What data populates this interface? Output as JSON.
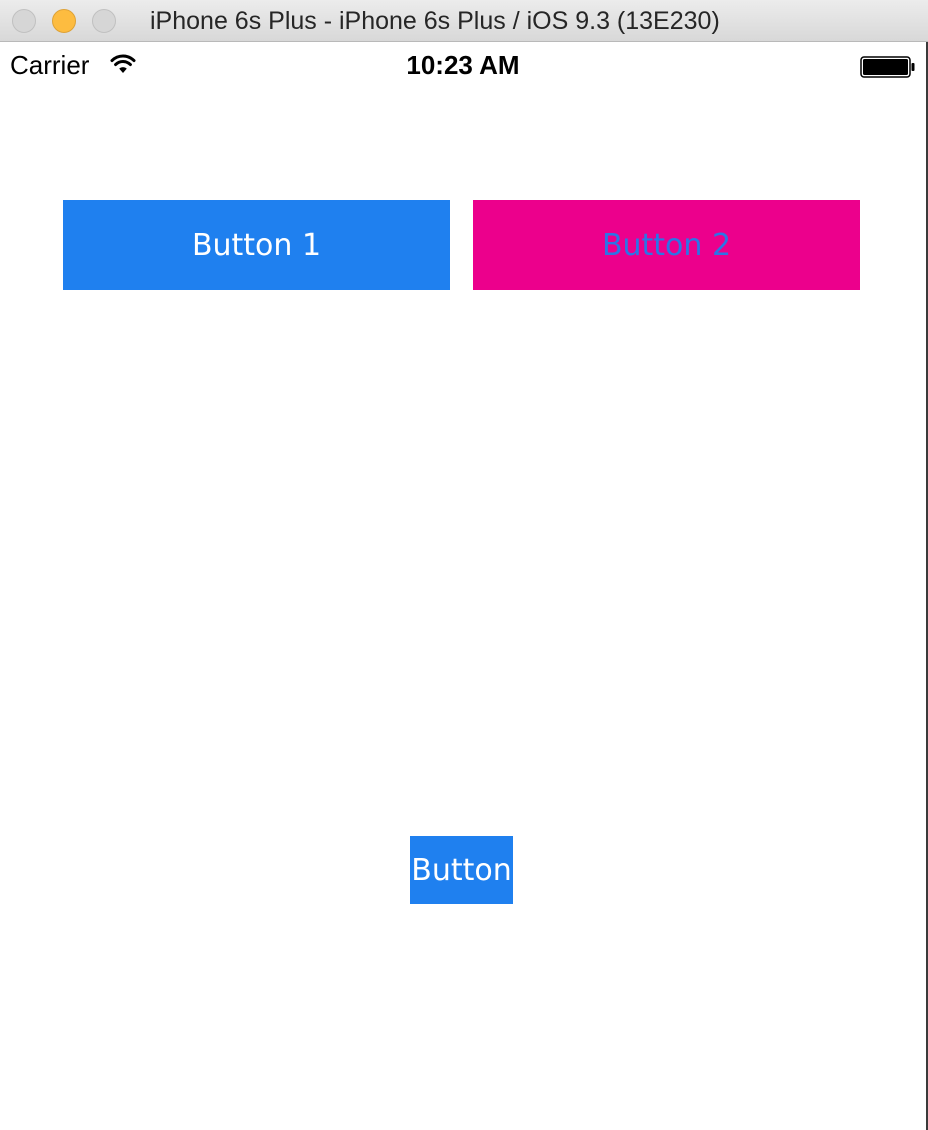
{
  "window": {
    "title": "iPhone 6s Plus - iPhone 6s Plus / iOS 9.3 (13E230)"
  },
  "status_bar": {
    "carrier": "Carrier",
    "time": "10:23 AM",
    "wifi_icon": "wifi-icon",
    "battery_icon": "battery-icon"
  },
  "buttons": [
    {
      "label": "Button 1",
      "background": "#1f80ef",
      "text_color": "#ffffff"
    },
    {
      "label": "Button 2",
      "background": "#ec008c",
      "text_color": "#2c74e6"
    },
    {
      "label": "Button",
      "background": "#1f80ef",
      "text_color": "#ffffff"
    }
  ]
}
